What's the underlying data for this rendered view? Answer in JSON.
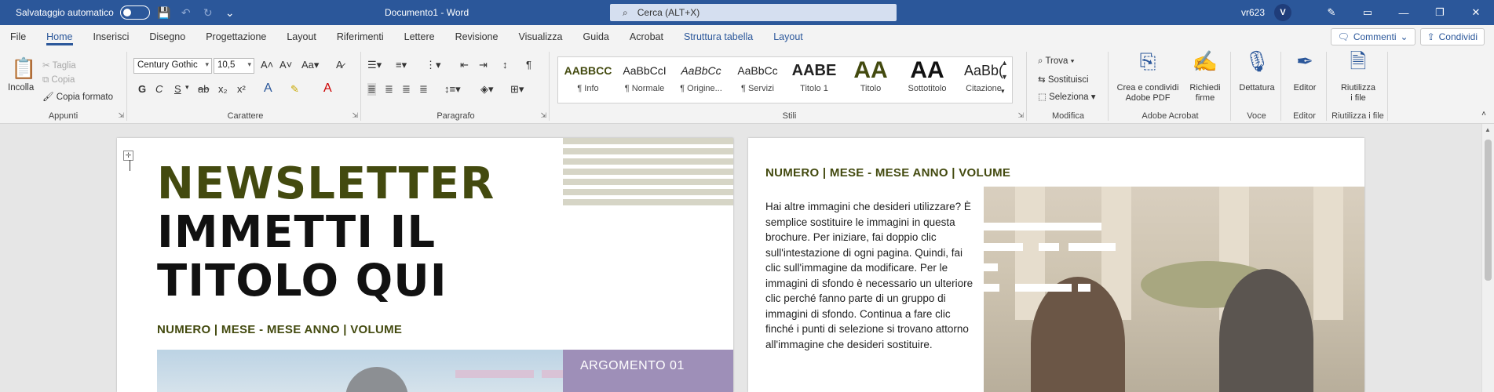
{
  "titlebar": {
    "autosave_label": "Salvataggio automatico",
    "doc_title": "Documento1  -  Word",
    "search_placeholder": "Cerca (ALT+X)",
    "user": "vr623",
    "avatar_initial": "V"
  },
  "menu": {
    "tabs": [
      "File",
      "Home",
      "Inserisci",
      "Disegno",
      "Progettazione",
      "Layout",
      "Riferimenti",
      "Lettere",
      "Revisione",
      "Visualizza",
      "Guida",
      "Acrobat",
      "Struttura tabella",
      "Layout"
    ],
    "comments_label": "Commenti",
    "share_label": "Condividi"
  },
  "ribbon": {
    "clipboard": {
      "paste": "Incolla",
      "cut": "Taglia",
      "copy": "Copia",
      "format_painter": "Copia formato",
      "label": "Appunti"
    },
    "font": {
      "family": "Century Gothic",
      "size": "10,5",
      "label": "Carattere"
    },
    "paragraph": {
      "label": "Paragrafo"
    },
    "styles": {
      "label": "Stili",
      "items": [
        {
          "preview": "AABBCC",
          "name": "¶ Info"
        },
        {
          "preview": "AaBbCcI",
          "name": "¶ Normale"
        },
        {
          "preview": "AaBbCc",
          "name": "¶ Origine..."
        },
        {
          "preview": "AaBbCc",
          "name": "¶ Servizi"
        },
        {
          "preview": "AABE",
          "name": "Titolo 1"
        },
        {
          "preview": "AA",
          "name": "Titolo"
        },
        {
          "preview": "AA",
          "name": "Sottotitolo"
        },
        {
          "preview": "AaBb(",
          "name": "Citazione"
        }
      ]
    },
    "editing": {
      "find": "Trova",
      "replace": "Sostituisci",
      "select": "Seleziona",
      "label": "Modifica"
    },
    "acrobat": {
      "create": "Crea e condividi\nAdobe PDF",
      "sign": "Richiedi\nfirme",
      "label": "Adobe Acrobat"
    },
    "voice": {
      "dictate": "Dettatura",
      "label": "Voce"
    },
    "editor": {
      "button": "Editor",
      "label": "Editor"
    },
    "reuse": {
      "button": "Riutilizza\ni file",
      "label": "Riutilizza i file"
    }
  },
  "document": {
    "page1": {
      "title_line1": "NEWSLETTER",
      "title_line2": "IMMETTI IL",
      "title_line3": "TITOLO QUI",
      "issue_line": "NUMERO   |   MESE - MESE ANNO   |   VOLUME",
      "topic": "ARGOMENTO 01"
    },
    "page2": {
      "issue_line": "NUMERO   |   MESE - MESE ANNO   |   VOLUME",
      "body": "Hai altre immagini che desideri utilizzare? È semplice sostituire le immagini in questa brochure. Per iniziare, fai doppio clic sull'intestazione di ogni pagina. Quindi, fai clic sull'immagine da modificare. Per le immagini di sfondo è necessario un ulteriore clic perché fanno parte di un gruppo di immagini di sfondo. Continua a fare clic finché i punti di selezione si trovano attorno all'immagine che desideri sostituire."
    }
  }
}
